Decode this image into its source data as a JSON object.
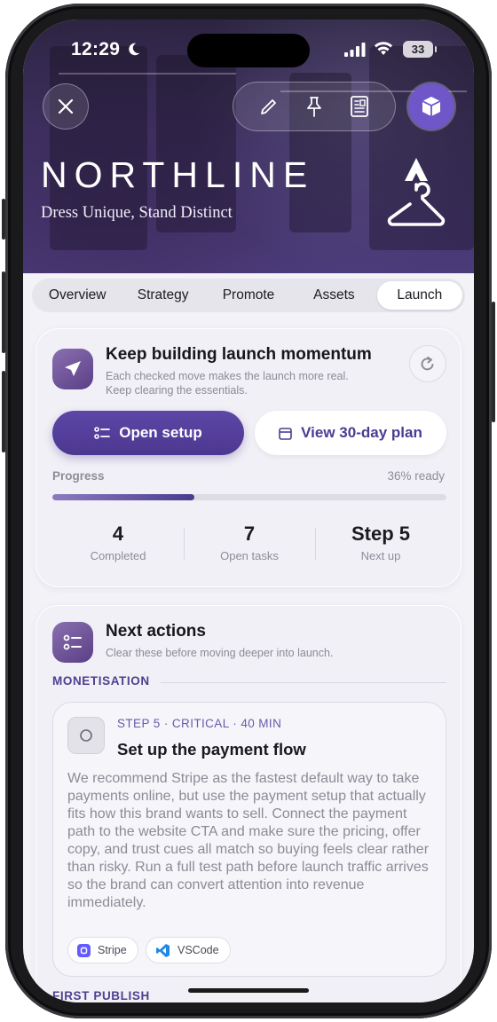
{
  "status_bar": {
    "time": "12:29",
    "battery": "33"
  },
  "hero": {
    "brand_name": "NORTHLINE",
    "tagline": "Dress Unique, Stand Distinct"
  },
  "icons": {
    "close": "close-icon",
    "edit": "pencil-icon",
    "pin": "pin-icon",
    "document": "document-icon",
    "box": "box-icon",
    "logo": "hanger-logo"
  },
  "tabs": [
    "Overview",
    "Strategy",
    "Promote",
    "Assets",
    "Launch"
  ],
  "active_tab": "Launch",
  "momentum": {
    "title": "Keep building launch momentum",
    "subtitle_line1": "Each checked move makes the launch more real.",
    "subtitle_line2": "Keep clearing the essentials.",
    "primary_button": "Open setup",
    "secondary_button": "View 30-day plan",
    "progress_label": "Progress",
    "progress_text": "36% ready",
    "progress_value": 0.36,
    "stats": [
      {
        "value": "4",
        "label": "Completed"
      },
      {
        "value": "7",
        "label": "Open tasks"
      },
      {
        "value": "Step 5",
        "label": "Next up"
      }
    ]
  },
  "next_actions": {
    "title": "Next actions",
    "subtitle": "Clear these before moving deeper into launch.",
    "section_label": "MONETISATION",
    "task": {
      "step": "STEP 5",
      "priority": "CRITICAL",
      "duration": "40 MIN",
      "title": "Set up the payment flow",
      "description": "We recommend Stripe as the fastest default way to take payments online, but use the payment setup that actually fits how this brand wants to sell. Connect the payment path to the website CTA and make sure the pricing, offer copy, and trust cues all match so buying feels clear rather than risky. Run a full test path before launch traffic arrives so the brand can convert attention into revenue immediately.",
      "chips": [
        "Stripe",
        "VSCode"
      ]
    },
    "next_section_label": "FIRST PUBLISH"
  },
  "colors": {
    "accent": "#4c3790",
    "section": "#4f3f8e",
    "stripe": "#635bff",
    "vscode": "#1e88e5"
  }
}
